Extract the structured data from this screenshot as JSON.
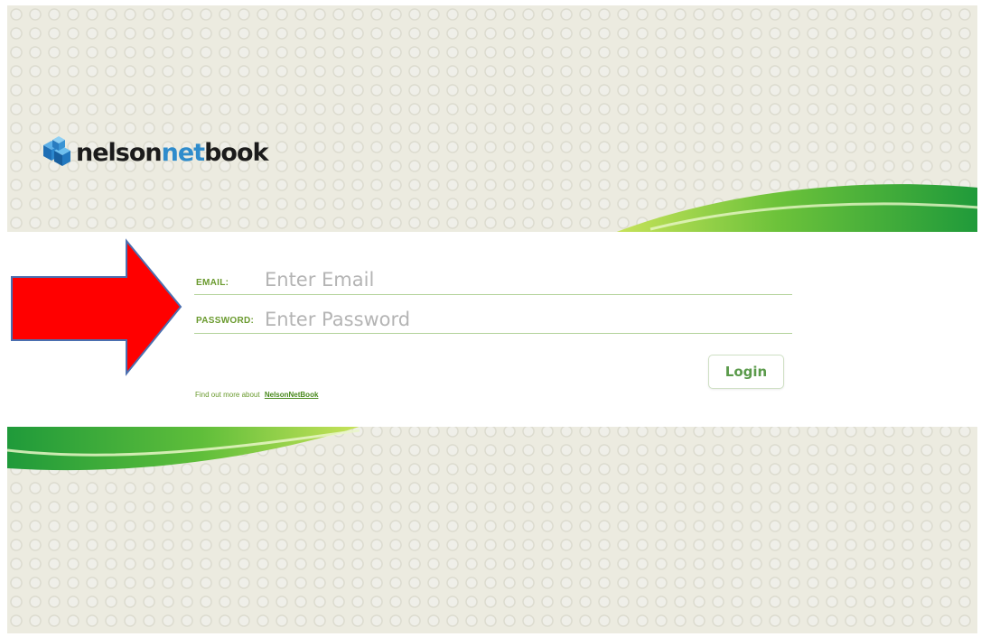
{
  "brand": {
    "logo_prefix": "nelson",
    "logo_net": "net",
    "logo_suffix": "book"
  },
  "login_form": {
    "email_label": "EMAIL:",
    "email_placeholder": "Enter Email",
    "password_label": "PASSWORD:",
    "password_placeholder": "Enter Password",
    "login_label": "Login",
    "find_out_text": "Find out more about",
    "find_out_link": "NelsonNetBook"
  },
  "colors": {
    "accent_green": "#6a9a2e",
    "brand_blue": "#2e8ccc",
    "arrow_red": "#ff0000"
  }
}
